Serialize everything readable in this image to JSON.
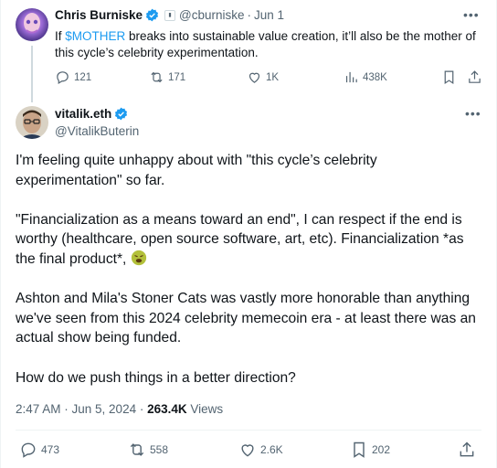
{
  "parent_tweet": {
    "author_name": "Chris Burniske",
    "handle": "@cburniske",
    "separator": "·",
    "date": "Jun 1",
    "text_prefix": "If ",
    "cashtag": "$MOTHER",
    "text_suffix": " breaks into sustainable value creation, it’ll also be the mother of this cycle’s celebrity experimentation.",
    "replies": "121",
    "reposts": "171",
    "likes": "1K",
    "views": "438K"
  },
  "main_tweet": {
    "author_name": "vitalik.eth",
    "handle": "@VitalikButerin",
    "paragraphs": [
      "I'm feeling quite unhappy about with \"this cycle’s celebrity experimentation\" so far.",
      "\"Financialization as a means toward an end\", I can respect if the end is worthy (healthcare, open source software, art, etc). Financialization *as the final product*, ",
      "Ashton and Mila's Stoner Cats was vastly more honorable than anything we've seen from this 2024 celebrity memecoin era - at least there was an actual show being funded.",
      "How do we push things in a better direction?"
    ],
    "timestamp": "2:47 AM · Jun 5, 2024 · ",
    "views_count": "263.4K",
    "views_label": " Views",
    "replies": "473",
    "reposts": "558",
    "likes": "2.6K",
    "bookmarks": "202"
  },
  "colors": {
    "accent": "#1d9bf0",
    "text": "#0f1419",
    "muted": "#536471",
    "border": "#eff3f4"
  },
  "icons": [
    "verified-badge-icon",
    "more-icon",
    "reply-icon",
    "repost-icon",
    "like-icon",
    "views-icon",
    "bookmark-icon",
    "share-icon",
    "nauseated-face-emoji"
  ]
}
